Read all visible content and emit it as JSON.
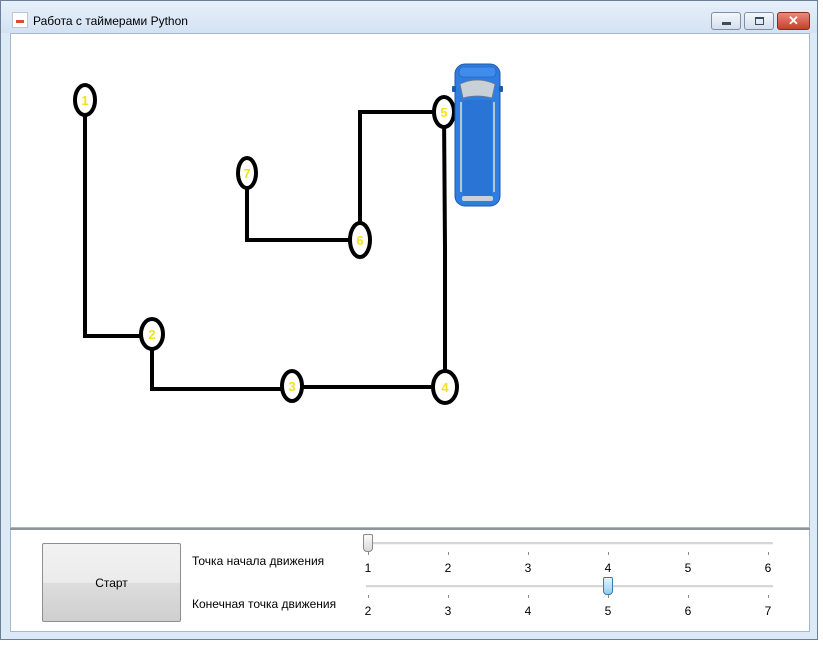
{
  "window": {
    "title": "Работа с таймерами Python",
    "controls": {
      "minimize": "minimize-icon",
      "maximize": "maximize-icon",
      "close": "✕"
    }
  },
  "map": {
    "points": [
      {
        "label": "1"
      },
      {
        "label": "2"
      },
      {
        "label": "3"
      },
      {
        "label": "4"
      },
      {
        "label": "5"
      },
      {
        "label": "6"
      },
      {
        "label": "7"
      }
    ],
    "point_label_color": "#f2e21e",
    "line_color": "#000000",
    "vehicle": {
      "icon": "van-icon",
      "color": "#2f7de0"
    }
  },
  "controls": {
    "start_label": "Старт",
    "start_point_label": "Точка начала движения",
    "end_point_label": "Конечная точка движения",
    "start_slider": {
      "ticks": [
        "1",
        "2",
        "3",
        "4",
        "5",
        "6"
      ],
      "value": 1,
      "min": 1,
      "max": 6
    },
    "end_slider": {
      "ticks": [
        "2",
        "3",
        "4",
        "5",
        "6",
        "7"
      ],
      "value": 5,
      "min": 2,
      "max": 7
    }
  }
}
